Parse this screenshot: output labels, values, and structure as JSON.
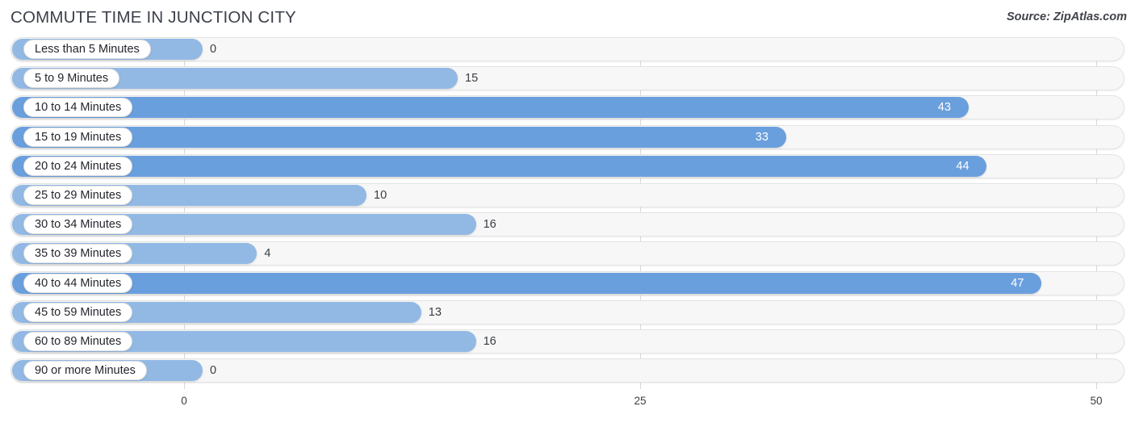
{
  "header": {
    "title": "COMMUTE TIME IN JUNCTION CITY",
    "source": "Source: ZipAtlas.com"
  },
  "chart_data": {
    "type": "bar",
    "orientation": "horizontal",
    "title": "COMMUTE TIME IN JUNCTION CITY",
    "xlabel": "",
    "ylabel": "",
    "xlim": [
      0,
      50
    ],
    "ticks": [
      "0",
      "25",
      "50"
    ],
    "tick_values": [
      0,
      25,
      50
    ],
    "grid": true,
    "legend": false,
    "categories": [
      "Less than 5 Minutes",
      "5 to 9 Minutes",
      "10 to 14 Minutes",
      "15 to 19 Minutes",
      "20 to 24 Minutes",
      "25 to 29 Minutes",
      "30 to 34 Minutes",
      "35 to 39 Minutes",
      "40 to 44 Minutes",
      "45 to 59 Minutes",
      "60 to 89 Minutes",
      "90 or more Minutes"
    ],
    "values": [
      0,
      15,
      43,
      33,
      44,
      10,
      16,
      4,
      47,
      13,
      16,
      0
    ],
    "value_labels": [
      "0",
      "15",
      "43",
      "33",
      "44",
      "10",
      "16",
      "4",
      "47",
      "13",
      "16",
      "0"
    ],
    "colors": {
      "bar_dark": "#6a9fdd",
      "bar_light": "#92b9e4",
      "track": "#f7f7f7",
      "track_border": "#e3e3e3",
      "label_pill": "#ffffff",
      "gridline": "#d8d8d8",
      "text": "#3a3d44"
    }
  }
}
